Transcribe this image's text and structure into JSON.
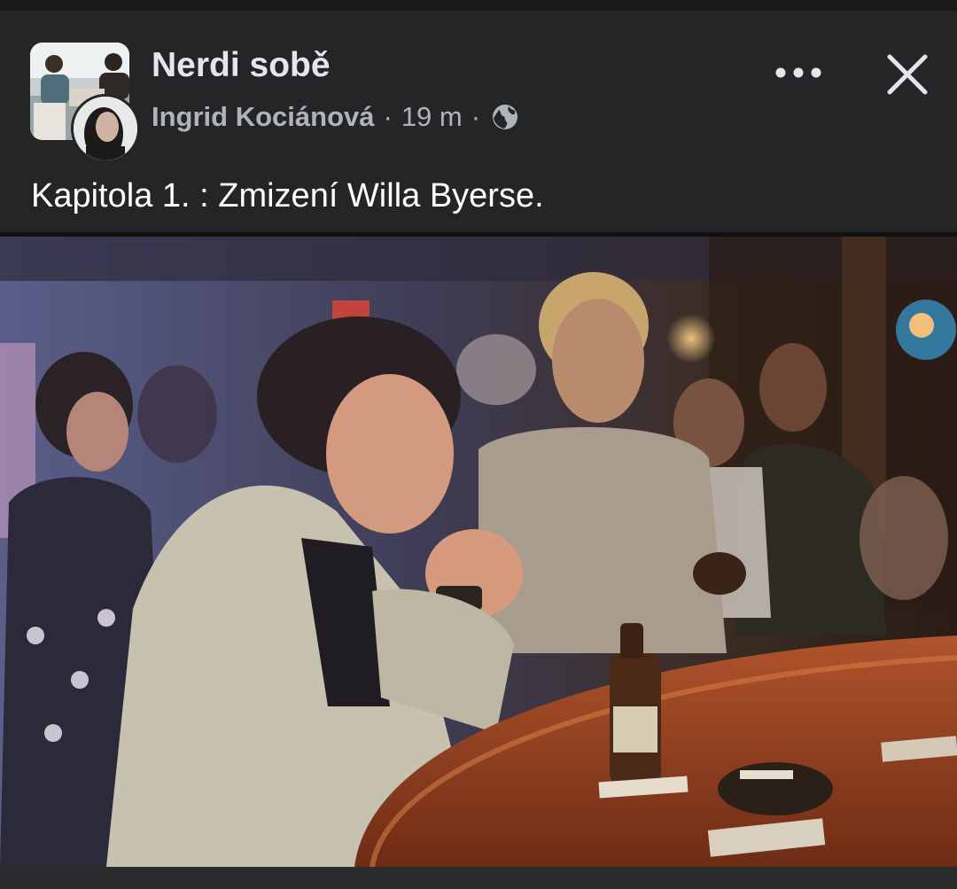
{
  "post": {
    "group_name": "Nerdi sobě",
    "author": "Ingrid Kociánová",
    "separator": "·",
    "time": "19 m",
    "audience_icon": "globe-icon",
    "text": "Kapitola 1. : Zmizení Willa Byerse.",
    "more_icon": "more-options-icon",
    "close_icon": "close-icon"
  },
  "colors": {
    "background": "#242526",
    "primary_text": "#e4e6eb",
    "secondary_text": "#b0b3b8"
  }
}
